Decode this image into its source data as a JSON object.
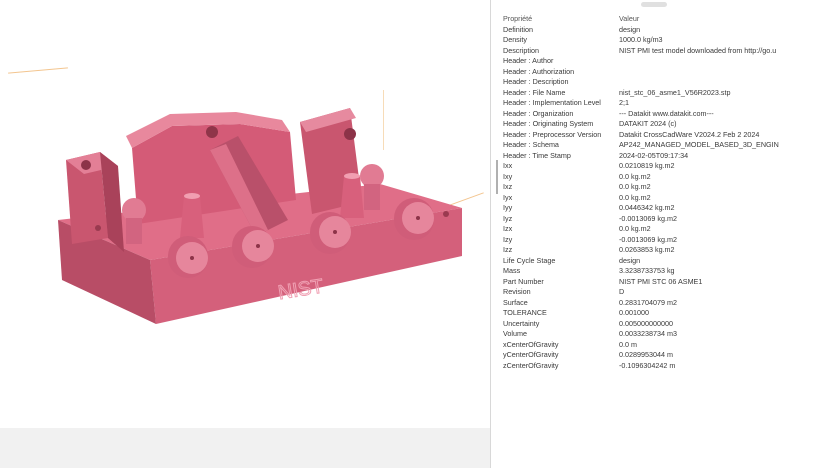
{
  "viewer": {
    "logo_text": "NIST",
    "model_color": "#d9627d"
  },
  "properties": {
    "columns": {
      "key": "Propriété",
      "value": "Valeur"
    },
    "rows": [
      {
        "key": "Definition",
        "value": "design"
      },
      {
        "key": "Density",
        "value": "1000.0 kg/m3"
      },
      {
        "key": "Description",
        "value": "NIST PMI test model downloaded from http://go.u"
      },
      {
        "key": "Header : Author",
        "value": ""
      },
      {
        "key": "Header : Authorization",
        "value": ""
      },
      {
        "key": "Header : Description",
        "value": ""
      },
      {
        "key": "Header : File Name",
        "value": "nist_stc_06_asme1_V56R2023.stp"
      },
      {
        "key": "Header : Implementation Level",
        "value": "2;1"
      },
      {
        "key": "Header : Organization",
        "value": "--- Datakit www.datakit.com---"
      },
      {
        "key": "Header : Originating System",
        "value": "DATAKIT 2024 (c)"
      },
      {
        "key": "Header : Preprocessor Version",
        "value": "Datakit CrossCadWare V2024.2  Feb  2 2024"
      },
      {
        "key": "Header : Schema",
        "value": "AP242_MANAGED_MODEL_BASED_3D_ENGIN"
      },
      {
        "key": "Header : Time Stamp",
        "value": "2024-02-05T09:17:34"
      },
      {
        "key": "Ixx",
        "value": "0.0210819 kg.m2"
      },
      {
        "key": "Ixy",
        "value": "0.0 kg.m2"
      },
      {
        "key": "Ixz",
        "value": "0.0 kg.m2"
      },
      {
        "key": "Iyx",
        "value": "0.0 kg.m2"
      },
      {
        "key": "Iyy",
        "value": "0.0446342 kg.m2"
      },
      {
        "key": "Iyz",
        "value": "-0.0013069 kg.m2"
      },
      {
        "key": "Izx",
        "value": "0.0 kg.m2"
      },
      {
        "key": "Izy",
        "value": "-0.0013069 kg.m2"
      },
      {
        "key": "Izz",
        "value": "0.0263853 kg.m2"
      },
      {
        "key": "Life Cycle Stage",
        "value": "design"
      },
      {
        "key": "Mass",
        "value": "3.3238733753 kg"
      },
      {
        "key": "Part Number",
        "value": "NIST PMI STC 06 ASME1"
      },
      {
        "key": "Revision",
        "value": "D"
      },
      {
        "key": "Surface",
        "value": "0.2831704079 m2"
      },
      {
        "key": "TOLERANCE",
        "value": "0.001000"
      },
      {
        "key": "Uncertainty",
        "value": "0.005000000000"
      },
      {
        "key": "Volume",
        "value": "0.0033238734 m3"
      },
      {
        "key": "xCenterOfGravity",
        "value": "0.0 m"
      },
      {
        "key": "yCenterOfGravity",
        "value": "0.0289953044 m"
      },
      {
        "key": "zCenterOfGravity",
        "value": "-0.1096304242 m"
      }
    ]
  }
}
